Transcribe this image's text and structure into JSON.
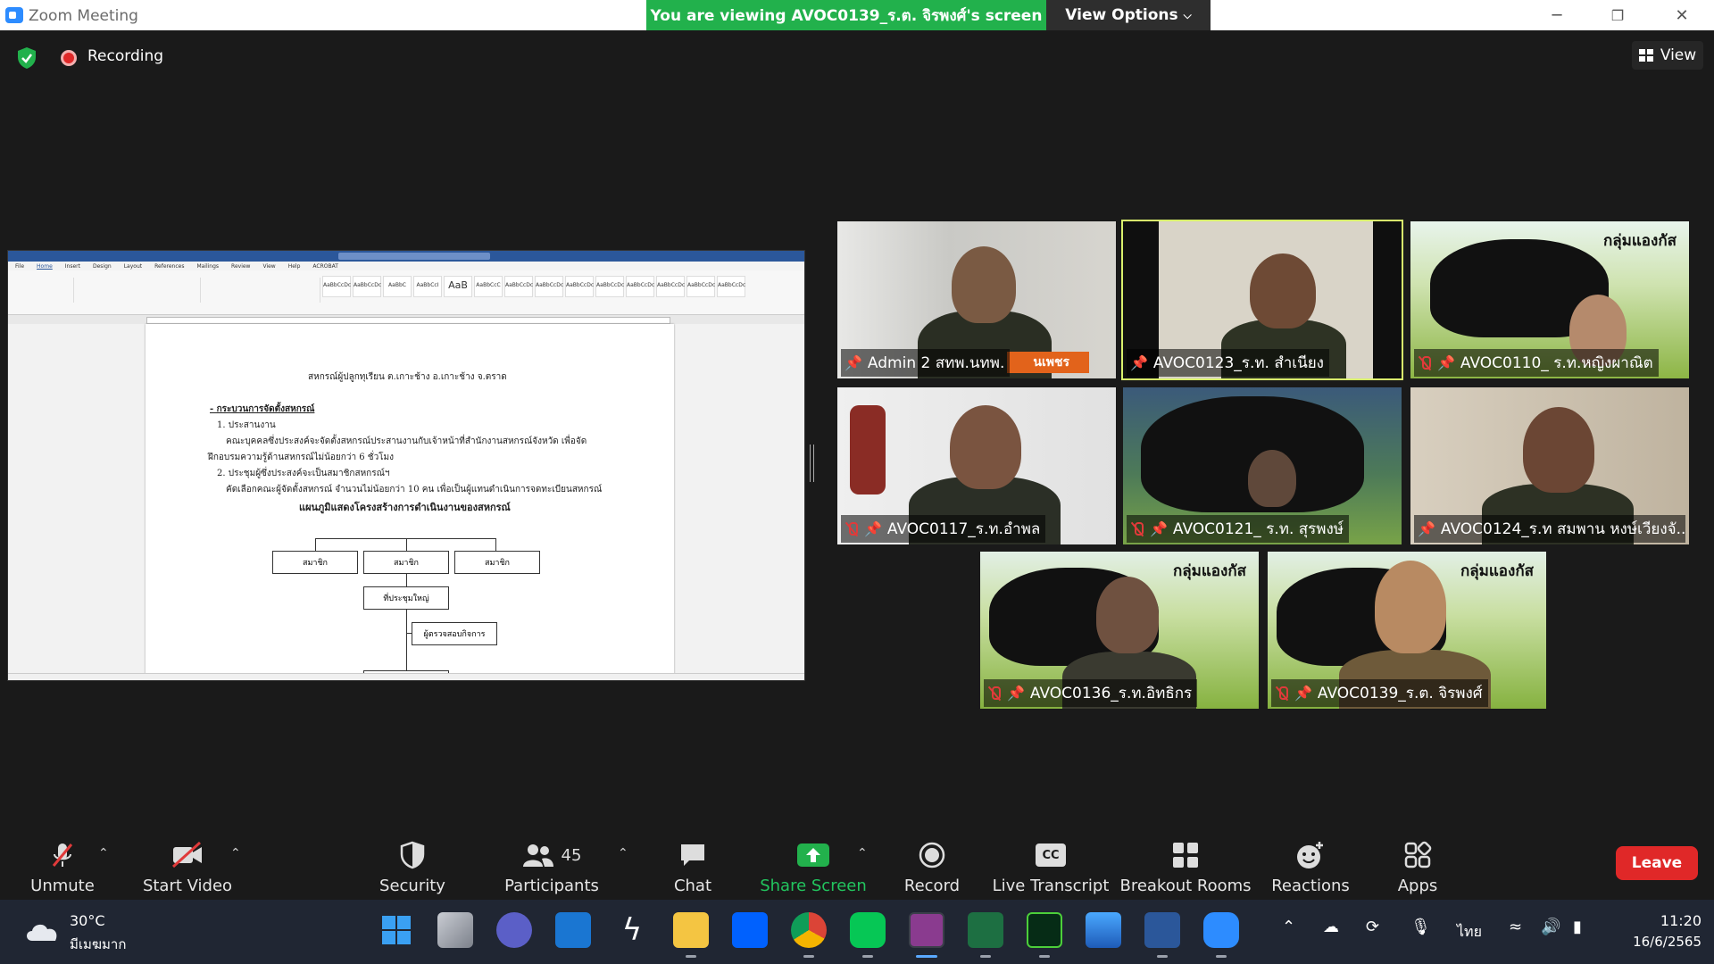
{
  "window": {
    "title": "Zoom Meeting",
    "viewing_banner": "You are viewing AVOC0139_ร.ต. จิรพงศ์'s screen",
    "view_options": "View Options",
    "minimize": "─",
    "restore": "❐",
    "close": "✕"
  },
  "meeting": {
    "recording_label": "Recording",
    "view_label": "View"
  },
  "shared_doc": {
    "menu": [
      "File",
      "Home",
      "Insert",
      "Design",
      "Layout",
      "References",
      "Mailings",
      "Review",
      "View",
      "Help",
      "ACROBAT"
    ],
    "styles": [
      "AaBbCcDc",
      "AaBbCcDc",
      "AaBbC",
      "AaBbCcI",
      "AaB",
      "AaBbCcC",
      "AaBbCcDc",
      "AaBbCcDc",
      "AaBbCcDc",
      "AaBbCcDc",
      "AaBbCcDc",
      "AaBbCcDc",
      "AaBbCcDc",
      "AaBbCcDc"
    ],
    "heading": "สหกรณ์ผู้ปลูกทุเรียน ต.เกาะช้าง อ.เกาะช้าง จ.ตราด",
    "section": "- กระบวนการจัดตั้งสหกรณ์",
    "item1": "1. ประสานงาน",
    "item1_body": "คณะบุคคลซึ่งประสงค์จะจัดตั้งสหกรณ์ประสานงานกับเจ้าหน้าที่สำนักงานสหกรณ์จังหวัด เพื่อจัด",
    "item1_body2": "ฝึกอบรมความรู้ด้านสหกรณ์ไม่น้อยกว่า 6 ชั่วโมง",
    "item2": "2. ประชุมผู้ซึ่งประสงค์จะเป็นสมาชิกสหกรณ์ฯ",
    "item2_body": "คัดเลือกคณะผู้จัดตั้งสหกรณ์ จำนวนไม่น้อยกว่า 10 คน เพื่อเป็นผู้แทนดำเนินการจดทะเบียนสหกรณ์",
    "chart_title": "แผนภูมิแสดงโครงสร้างการดำเนินงานของสหกรณ์",
    "org_members": [
      "สมาชิก",
      "สมาชิก",
      "สมาชิก"
    ],
    "org_assembly": "ที่ประชุมใหญ่",
    "org_auditor": "ผู้ตรวจสอบกิจการ"
  },
  "participants_tiles": [
    {
      "name": "Admin 2 สทพ.นทพ.",
      "muted": false,
      "active": false
    },
    {
      "name": "AVOC0123_ร.ท. สำเนียง",
      "muted": false,
      "active": true
    },
    {
      "name": "AVOC0110_ ร.ท.หญิงผาณิต",
      "muted": true,
      "active": false,
      "group_tag": "กลุ่มแองกัส"
    },
    {
      "name": "AVOC0117_ร.ท.อำพล",
      "muted": true,
      "active": false
    },
    {
      "name": "AVOC0121_ ร.ท. สุรพงษ์",
      "muted": true,
      "active": false
    },
    {
      "name": "AVOC0124_ร.ท สมพาน หงษ์เวียงจั...",
      "muted": false,
      "active": false
    },
    {
      "name": "AVOC0136_ร.ท.อิทธิกร",
      "muted": true,
      "active": false,
      "group_tag": "กลุ่มแองกัส"
    },
    {
      "name": "AVOC0139_ร.ต. จิรพงศ์",
      "muted": true,
      "active": false,
      "group_tag": "กลุ่มแองกัส"
    }
  ],
  "overlay_tag": "นเพชร",
  "toolbar": {
    "unmute": "Unmute",
    "start_video": "Start Video",
    "security": "Security",
    "participants": "Participants",
    "participants_count": "45",
    "chat": "Chat",
    "share_screen": "Share Screen",
    "record": "Record",
    "live_transcript": "Live Transcript",
    "cc": "CC",
    "breakout_rooms": "Breakout Rooms",
    "reactions": "Reactions",
    "apps": "Apps",
    "leave": "Leave"
  },
  "taskbar": {
    "temperature": "30°C",
    "weather": "มีเมฆมาก",
    "language": "ไทย",
    "time": "11:20",
    "date": "16/6/2565"
  },
  "colors": {
    "banner": "#22b14c",
    "leave": "#e02828",
    "active_speaker": "#d9f06c",
    "share_green": "#22b14c"
  }
}
